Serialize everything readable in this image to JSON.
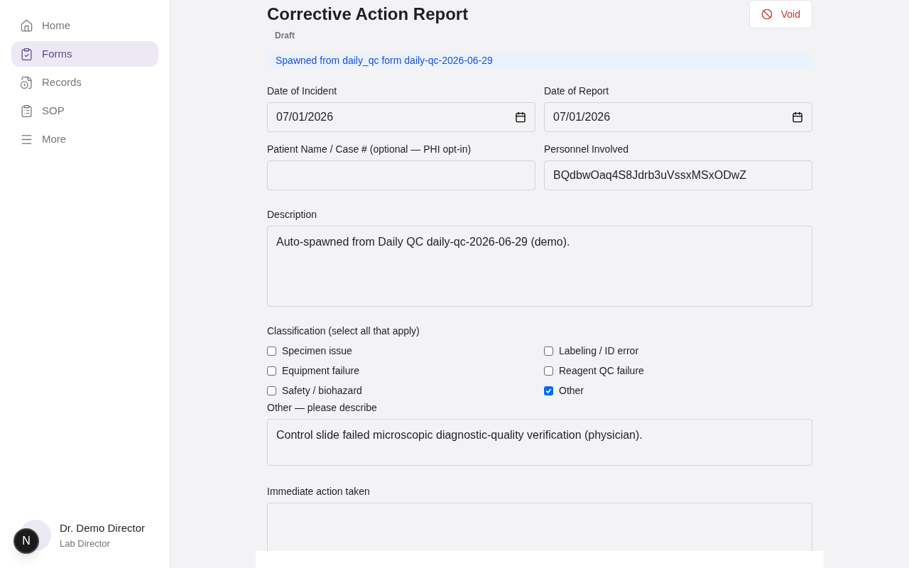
{
  "sidebar": {
    "items": [
      {
        "label": "Home",
        "selected": false
      },
      {
        "label": "Forms",
        "selected": true
      },
      {
        "label": "Records",
        "selected": false
      },
      {
        "label": "SOP",
        "selected": false
      },
      {
        "label": "More",
        "selected": false
      }
    ],
    "user": {
      "name": "Dr. Demo Director",
      "role": "Lab Director"
    },
    "dev_badge": "N"
  },
  "header": {
    "title": "Corrective Action Report",
    "status": "Draft",
    "void_button": "Void"
  },
  "notice": "Spawned from daily_qc form daily-qc-2026-06-29",
  "fields_row1": [
    {
      "label": "Date of Incident",
      "value": "07/01/2026",
      "kind": "date"
    },
    {
      "label": "Date of Report",
      "value": "07/01/2026",
      "kind": "date"
    }
  ],
  "fields_row2": [
    {
      "label": "Patient Name / Case # (optional — PHI opt-in)",
      "kind": "text"
    },
    {
      "label": "Personnel Involved",
      "value": "BQdbwOaq4S8Jdrb3uVssxMSxODwZ",
      "kind": "text"
    }
  ],
  "description": {
    "label": "Description",
    "value": "Auto-spawned from Daily QC daily-qc-2026-06-29 (demo)."
  },
  "classification": {
    "label": "Classification (select all that apply)",
    "options": [
      {
        "label": "Specimen issue",
        "checked": false
      },
      {
        "label": "Labeling / ID error",
        "checked": false
      },
      {
        "label": "Equipment failure",
        "checked": false
      },
      {
        "label": "Reagent QC failure",
        "checked": false
      },
      {
        "label": "Safety / biohazard",
        "checked": false
      },
      {
        "label": "Other",
        "checked": true
      }
    ]
  },
  "other_description": {
    "label": "Other — please describe",
    "value": "Control slide failed microscopic diagnostic-quality verification (physician)."
  },
  "immediate_action": {
    "label": "Immediate action taken"
  }
}
